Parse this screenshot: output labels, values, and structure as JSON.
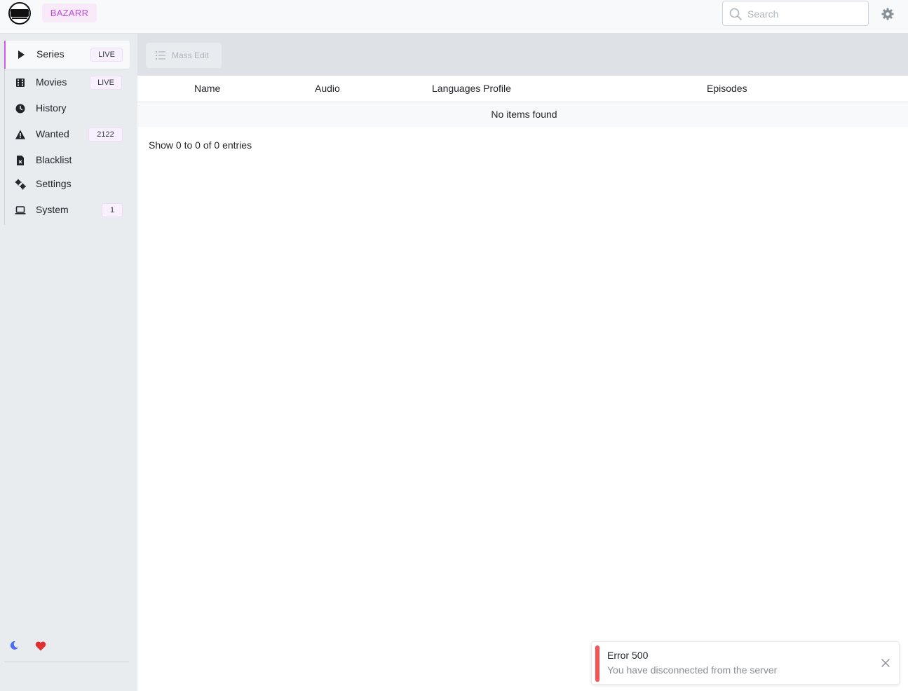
{
  "app": {
    "brand": "BAZARR",
    "search_placeholder": "Search"
  },
  "sidebar": {
    "items": [
      {
        "label": "Series",
        "badge": "LIVE",
        "icon": "play-icon",
        "active": true
      },
      {
        "label": "Movies",
        "badge": "LIVE",
        "icon": "film-icon",
        "active": false
      },
      {
        "label": "History",
        "badge": "",
        "icon": "clock-icon",
        "active": false
      },
      {
        "label": "Wanted",
        "badge": "2122",
        "icon": "warning-icon",
        "active": false
      },
      {
        "label": "Blacklist",
        "badge": "",
        "icon": "file-x-icon",
        "active": false
      },
      {
        "label": "Settings",
        "badge": "",
        "icon": "cogs-icon",
        "active": false
      },
      {
        "label": "System",
        "badge": "1",
        "icon": "laptop-icon",
        "active": false
      }
    ]
  },
  "toolbar": {
    "mass_edit_label": "Mass Edit"
  },
  "table": {
    "columns": [
      "Name",
      "Audio",
      "Languages Profile",
      "Episodes"
    ],
    "empty_message": "No items found",
    "pagination_text": "Show 0 to 0 of 0 entries"
  },
  "toast": {
    "title": "Error 500",
    "message": "You have disconnected from the server"
  },
  "colors": {
    "accent": "#be4bdb",
    "error": "#fa5252",
    "heart": "#e03131",
    "moon": "#4c6ef5"
  }
}
